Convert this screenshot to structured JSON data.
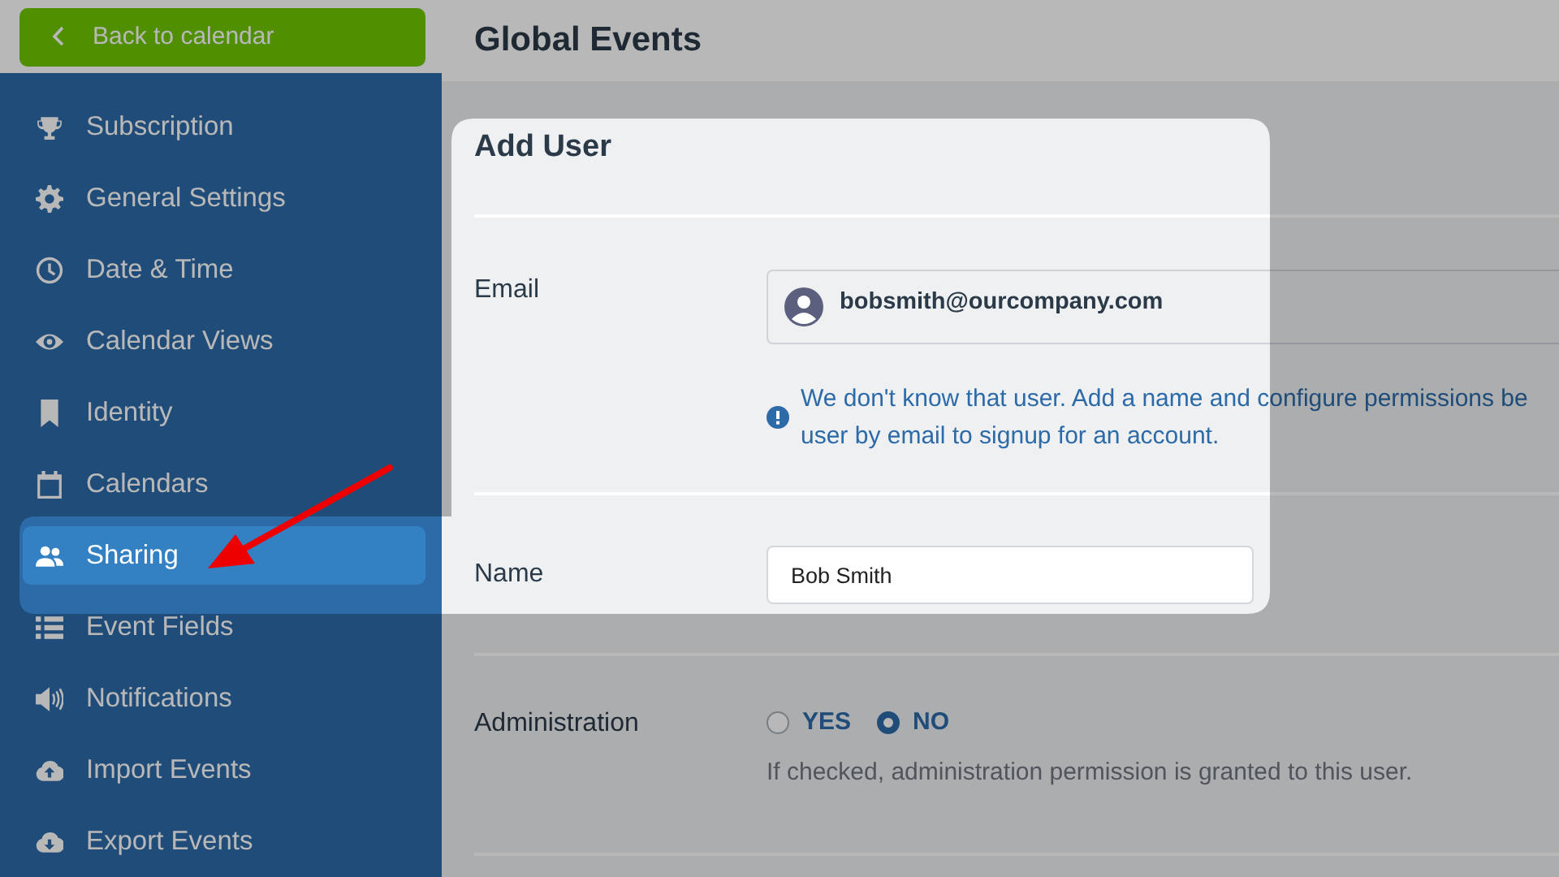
{
  "back_button": {
    "label": "Back to calendar"
  },
  "header": {
    "title": "Global Events"
  },
  "sidebar": {
    "items": [
      {
        "label": "Subscription",
        "selected": false
      },
      {
        "label": "General Settings",
        "selected": false
      },
      {
        "label": "Date & Time",
        "selected": false
      },
      {
        "label": "Calendar Views",
        "selected": false
      },
      {
        "label": "Identity",
        "selected": false
      },
      {
        "label": "Calendars",
        "selected": false
      },
      {
        "label": "Sharing",
        "selected": true
      },
      {
        "label": "Event Fields",
        "selected": false
      },
      {
        "label": "Notifications",
        "selected": false
      },
      {
        "label": "Import Events",
        "selected": false
      },
      {
        "label": "Export Events",
        "selected": false
      }
    ]
  },
  "form": {
    "title": "Add User",
    "email": {
      "label": "Email",
      "value": "bobsmith@ourcompany.com",
      "notice_lines": [
        "We don't know that user. Add a name and configure permissions be",
        "user by email to signup for an account."
      ]
    },
    "name": {
      "label": "Name",
      "value": "Bob Smith"
    },
    "administration": {
      "label": "Administration",
      "options": [
        {
          "label": "YES",
          "selected": false
        },
        {
          "label": "NO",
          "selected": true
        }
      ],
      "hint": "If checked, administration permission is granted to this user."
    }
  }
}
